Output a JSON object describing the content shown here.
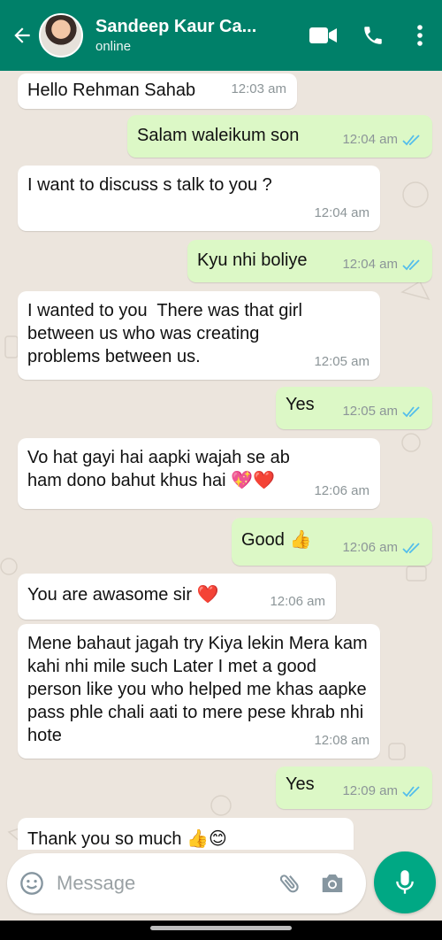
{
  "header": {
    "contact_name": "Sandeep Kaur Ca...",
    "status": "online",
    "color": "#008069"
  },
  "messages": [
    {
      "dir": "in",
      "text": "Hello Rehman Sahab",
      "time": "12:03 am"
    },
    {
      "dir": "out",
      "text": "Salam waleikum son",
      "time": "12:04 am",
      "read": true
    },
    {
      "dir": "in",
      "text": "I want to discuss s talk to you ?",
      "time": "12:04 am"
    },
    {
      "dir": "out",
      "text": "Kyu nhi boliye",
      "time": "12:04 am",
      "read": true
    },
    {
      "dir": "in",
      "text": "I wanted to you  There was that girl between us who was creating problems between us.",
      "time": "12:05 am"
    },
    {
      "dir": "out",
      "text": "Yes",
      "time": "12:05 am",
      "read": true
    },
    {
      "dir": "in",
      "text": "Vo hat gayi hai aapki wajah se ab ham dono bahut khus hai 💖❤️",
      "time": "12:06 am"
    },
    {
      "dir": "out",
      "text": "Good 👍",
      "time": "12:06 am",
      "read": true
    },
    {
      "dir": "in",
      "text": "You are awasome sir ❤️",
      "time": "12:06 am"
    },
    {
      "dir": "in",
      "text": "Mene bahaut jagah try Kiya lekin Mera kam kahi nhi mile such Later I met a good person like you who helped me khas aapke pass phle chali aati to mere pese khrab nhi hote",
      "time": "12:08 am"
    },
    {
      "dir": "out",
      "text": "Yes",
      "time": "12:09 am",
      "read": true
    },
    {
      "dir": "in",
      "text": "Thank you so much 👍😊",
      "time": ""
    }
  ],
  "composer": {
    "placeholder": "Message"
  },
  "icons": [
    "back-arrow-icon",
    "video-call-icon",
    "phone-icon",
    "more-options-icon",
    "emoji-icon",
    "attachment-icon",
    "camera-icon",
    "mic-icon"
  ],
  "colors": {
    "incoming": "#ffffff",
    "outgoing": "#dcf8c6",
    "read_ticks": "#53bdeb",
    "fab": "#00a884"
  }
}
